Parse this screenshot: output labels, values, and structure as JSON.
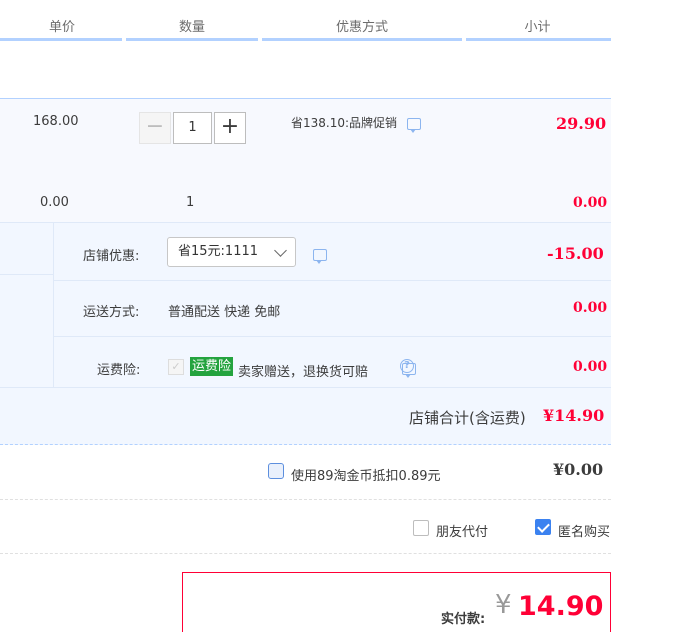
{
  "header": {
    "col_price": "单价",
    "col_qty": "数量",
    "col_discount": "优惠方式",
    "col_subtotal": "小计"
  },
  "item": {
    "unit_price": "168.00",
    "quantity": "1",
    "minus": "−",
    "plus": "+",
    "promo_text": "省138.10:品牌促销",
    "subtotal": "29.90"
  },
  "gift": {
    "unit_price": "0.00",
    "quantity": "1",
    "subtotal": "0.00"
  },
  "shop": {
    "discount_label": "店铺优惠:",
    "discount_select": "省15元:1111",
    "discount_value": "-15.00",
    "shipping_label": "运送方式:",
    "shipping_text": "普通配送 快递 免邮",
    "shipping_value": "0.00",
    "insurance_label": "运费险:",
    "insurance_tag": "运费险",
    "insurance_text": "卖家赠送，退换货可赔",
    "insurance_value": "0.00",
    "total_label": "店铺合计(含运费)",
    "total_value": "¥14.90"
  },
  "coins": {
    "label": "使用89淘金币抵扣0.89元",
    "value": "¥0.00"
  },
  "options": {
    "friend_pay": "朋友代付",
    "anonymous": "匿名购买"
  },
  "pay": {
    "label": "实付款:",
    "currency": "¥",
    "amount": "14.90"
  },
  "colors": {
    "accent_red": "#ff0036",
    "link_blue": "#b2d1ff",
    "green_tag": "#24a33e"
  }
}
